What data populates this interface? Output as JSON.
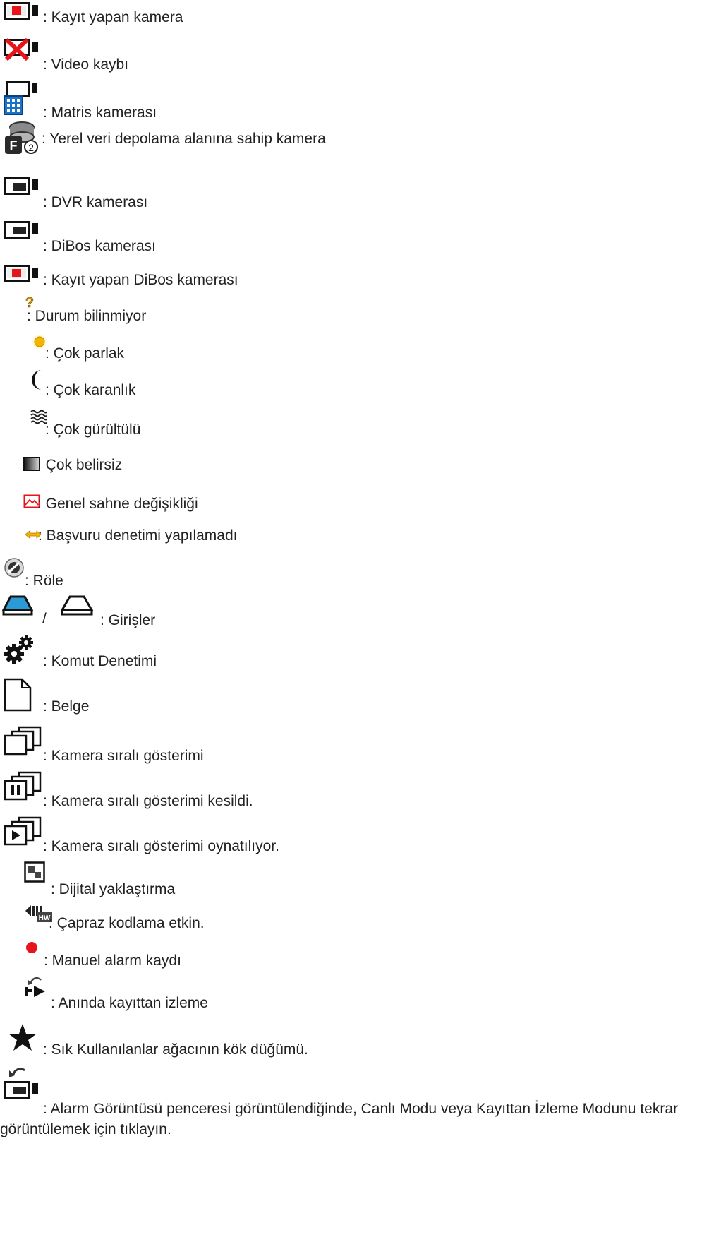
{
  "legend": {
    "items": [
      {
        "icon": "recording-camera-icon",
        "label": ": Kayıt yapan kamera"
      },
      {
        "icon": "video-loss-icon",
        "label": ": Video kaybı"
      },
      {
        "icon": "matrix-camera-icon",
        "label": ": Matris kamerası"
      },
      {
        "icon": "local-storage-camera-icon",
        "label": ": Yerel veri depolama alanına sahip kamera"
      },
      {
        "icon": "dvr-camera-icon",
        "label": ": DVR kamerası"
      },
      {
        "icon": "dibos-camera-icon",
        "label": ": DiBos kamerası"
      },
      {
        "icon": "recording-dibos-camera-icon",
        "label": ": Kayıt yapan DiBos kamerası"
      },
      {
        "icon": "question-mark-icon",
        "label": ": Durum bilinmiyor"
      },
      {
        "icon": "too-bright-icon",
        "label": ": Çok parlak"
      },
      {
        "icon": "too-dark-icon",
        "label": ": Çok karanlık"
      },
      {
        "icon": "too-noisy-icon",
        "label": ": Çok gürültülü"
      },
      {
        "icon": "too-blurry-icon",
        "label": ": Çok belirsiz"
      },
      {
        "icon": "scene-change-icon",
        "label": ": Genel sahne değişikliği"
      },
      {
        "icon": "reference-check-icon",
        "label": ": Başvuru denetimi yapılamadı"
      },
      {
        "icon": "relay-icon",
        "label": ": Röle"
      },
      {
        "icon": "input-icon",
        "label": ": Girişler",
        "separator": "/"
      },
      {
        "icon": "command-script-icon",
        "label": ": Komut Denetimi"
      },
      {
        "icon": "document-icon",
        "label": ": Belge"
      },
      {
        "icon": "camera-sequence-icon",
        "label": ": Kamera sıralı gösterimi"
      },
      {
        "icon": "sequence-paused-icon",
        "label": ": Kamera sıralı gösterimi kesildi."
      },
      {
        "icon": "sequence-playing-icon",
        "label": ": Kamera sıralı gösterimi oynatılıyor."
      },
      {
        "icon": "digital-zoom-icon",
        "label": ": Dijital yaklaştırma"
      },
      {
        "icon": "transcoding-icon",
        "label": ": Çapraz kodlama etkin."
      },
      {
        "icon": "manual-alarm-recording-icon",
        "label": ": Manuel alarm kaydı"
      },
      {
        "icon": "instant-playback-icon",
        "label": ": Anında kayıttan izleme"
      },
      {
        "icon": "favorites-star-icon",
        "label": ": Sık Kullanılanlar ağacının kök düğümü."
      },
      {
        "icon": "return-to-live-icon",
        "label": ": Alarm Görüntüsü penceresi görüntülendiğinde, Canlı Modu veya Kayıttan İzleme Modunu tekrar görüntülemek için tıklayın."
      }
    ]
  },
  "colors": {
    "text": "#222222",
    "recording": "#e8141c",
    "warning": "#f2a900",
    "accent": "#1a73c8"
  }
}
